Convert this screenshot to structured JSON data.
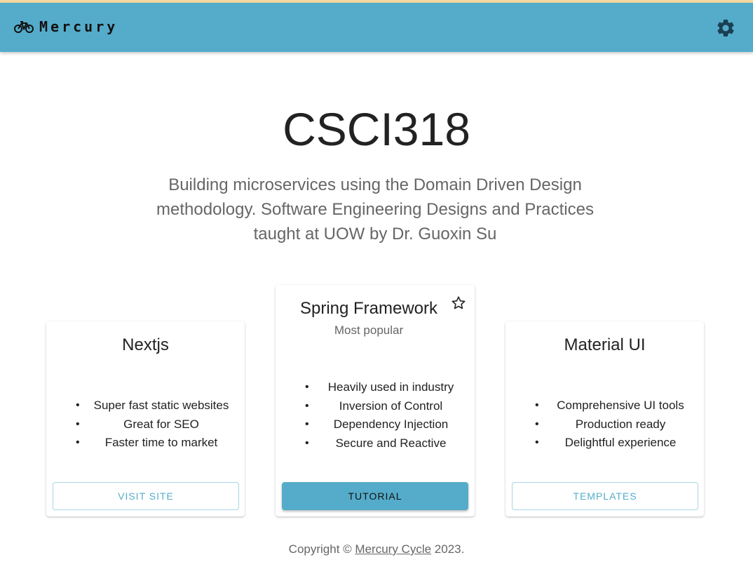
{
  "appbar": {
    "brand": "Mercury",
    "brand_icon": "bicycle-icon",
    "settings_icon": "gear-icon",
    "color": "#54acca"
  },
  "hero": {
    "title": "CSCI318",
    "subtitle": "Building microservices using the Domain Driven Design methodology. Software Engineering Designs and Practices taught at UOW by Dr. Guoxin Su"
  },
  "cards": [
    {
      "title": "Nextjs",
      "features": [
        "Super fast static websites",
        "Great for SEO",
        "Faster time to market"
      ],
      "button": "VISIT SITE",
      "button_variant": "outlined"
    },
    {
      "title": "Spring Framework",
      "subheader": "Most popular",
      "header_icon": "star-outline-icon",
      "features": [
        "Heavily used in industry",
        "Inversion of Control",
        "Dependency Injection",
        "Secure and Reactive"
      ],
      "button": "TUTORIAL",
      "button_variant": "contained"
    },
    {
      "title": "Material UI",
      "features": [
        "Comprehensive UI tools",
        "Production ready",
        "Delightful experience"
      ],
      "button": "TEMPLATES",
      "button_variant": "outlined"
    }
  ],
  "footer": {
    "prefix": "Copyright ©",
    "link": "Mercury Cycle",
    "suffix": "2023."
  }
}
